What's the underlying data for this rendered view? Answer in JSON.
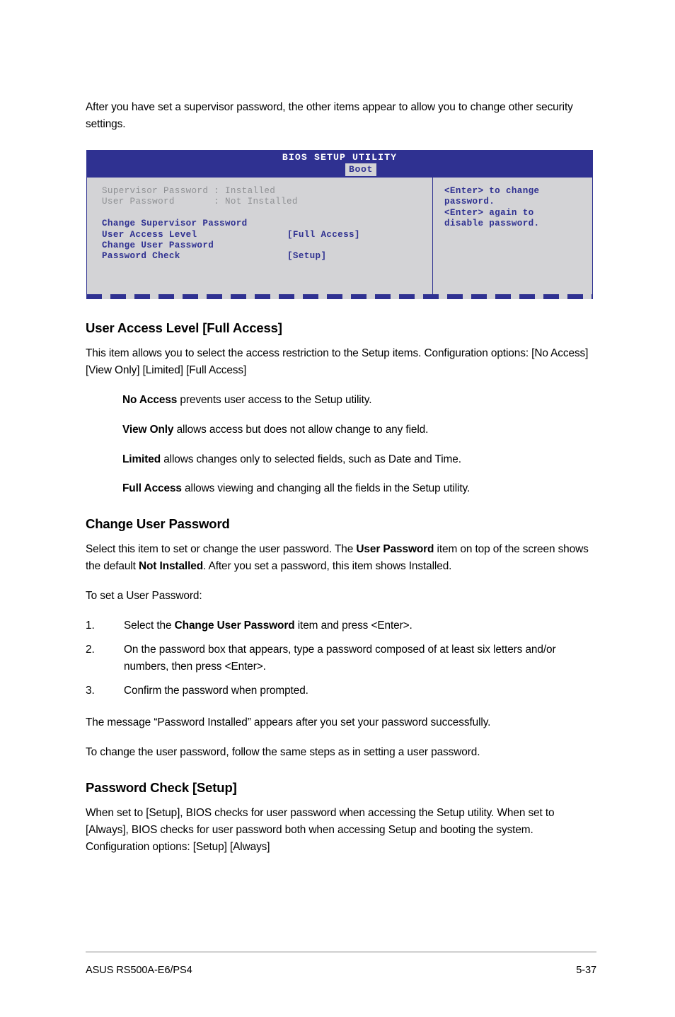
{
  "page": {
    "intro": "After you have set a supervisor password, the other items appear to allow you to change other security settings."
  },
  "bios": {
    "title": "BIOS SETUP UTILITY",
    "tab": "Boot",
    "status": [
      "Supervisor Password : Installed",
      "User Password       : Not Installed"
    ],
    "items": [
      {
        "label": "Change Supervisor Password",
        "value": ""
      },
      {
        "label": "User Access Level",
        "value": "[Full Access]"
      },
      {
        "label": "Change User Password",
        "value": ""
      },
      {
        "label": "Password Check",
        "value": "[Setup]"
      }
    ],
    "help": [
      "<Enter> to change",
      "password.",
      "<Enter> again to",
      "disable password."
    ],
    "colors": {
      "header_blue": "#2f3191",
      "panel_gray": "#d3d3d6",
      "dim_text": "#8f9194",
      "item_text": "#2f3191"
    }
  },
  "section_user_access": {
    "heading": "User Access Level [Full Access]",
    "paragraph": "This item allows you to select the access restriction to the Setup items. Configuration options: [No Access] [View Only] [Limited] [Full Access]",
    "definitions": [
      {
        "term": "No Access",
        "desc": " prevents user access to the Setup utility."
      },
      {
        "term": "View Only",
        "desc": " allows access but does not allow change to any field."
      },
      {
        "term": "Limited",
        "desc": " allows changes only to selected fields, such as Date and Time."
      },
      {
        "term": "Full Access",
        "desc": " allows viewing and changing all the fields in the Setup utility."
      }
    ]
  },
  "section_change_user_password": {
    "heading": "Change User Password",
    "para1_a": "Select this item to set or change the user password. The ",
    "para1_b": "User Password",
    "para1_c": " item on top of the screen shows the default ",
    "para1_d": "Not Installed",
    "para1_e": ". After you set a password, this item shows Installed.",
    "para2": "To set a User Password:",
    "steps": [
      {
        "num": "1.",
        "a": "Select the ",
        "b": "Change User Password",
        "c": " item and press <Enter>."
      },
      {
        "num": "2.",
        "a": "On the password box that appears, type a password composed of at least six letters and/or numbers, then press <Enter>.",
        "b": "",
        "c": ""
      },
      {
        "num": "3.",
        "a": "Confirm the password when prompted.",
        "b": "",
        "c": ""
      }
    ],
    "para3": "The message “Password Installed” appears after you set your password successfully.",
    "para4": "To change the user password, follow the same steps as in setting a user password."
  },
  "section_password_check": {
    "heading": "Password Check [Setup]",
    "paragraph": "When set to [Setup], BIOS checks for user password when accessing the Setup utility. When set to [Always], BIOS checks for user password both when accessing Setup and booting the system. Configuration options: [Setup] [Always]"
  },
  "footer": {
    "product": "ASUS RS500A-E6/PS4",
    "page_number": "5-37"
  }
}
